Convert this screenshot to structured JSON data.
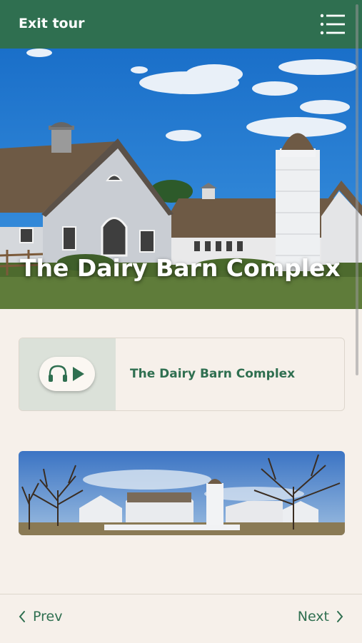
{
  "header": {
    "exit_label": "Exit tour",
    "menu_icon": "menu-list-icon"
  },
  "hero": {
    "title": "The Dairy Barn Complex"
  },
  "audio": {
    "title": "The Dairy Barn Complex",
    "icons": [
      "headphones-icon",
      "play-icon"
    ]
  },
  "footer": {
    "prev_label": "Prev",
    "next_label": "Next"
  },
  "colors": {
    "brand": "#2f6f50",
    "background": "#f6f0ea",
    "audio_panel": "#dbe1d9"
  }
}
